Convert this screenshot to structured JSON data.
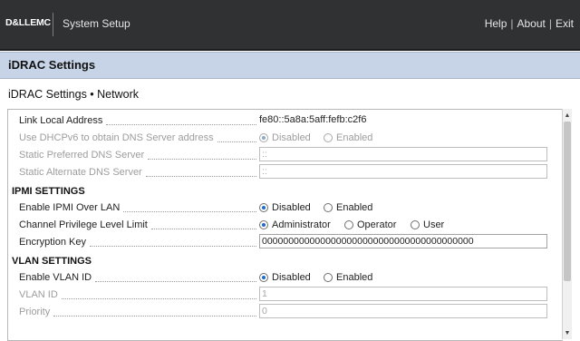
{
  "topbar": {
    "logo": "D&LLEMC",
    "app_title": "System Setup",
    "help": "Help",
    "about": "About",
    "exit": "Exit",
    "sep": "|"
  },
  "header": {
    "title": "iDRAC Settings"
  },
  "subheader": {
    "title": "iDRAC Settings • Network"
  },
  "rows": {
    "link_local": {
      "label": "Link Local Address",
      "value": "fe80::5a8a:5aff:fefb:c2f6"
    },
    "dhcpv6_dns": {
      "label": "Use DHCPv6 to obtain DNS Server address",
      "options": [
        "Disabled",
        "Enabled"
      ],
      "selected": "Disabled"
    },
    "static_pref_dns": {
      "label": "Static Preferred DNS Server",
      "value": "::"
    },
    "static_alt_dns": {
      "label": "Static Alternate DNS Server",
      "value": "::"
    }
  },
  "ipmi": {
    "section_title": "IPMI SETTINGS",
    "enable_ipmi": {
      "label": "Enable IPMI Over LAN",
      "options": [
        "Disabled",
        "Enabled"
      ],
      "selected": "Disabled"
    },
    "channel_priv": {
      "label": "Channel Privilege Level Limit",
      "options": [
        "Administrator",
        "Operator",
        "User"
      ],
      "selected": "Administrator"
    },
    "encryption_key": {
      "label": "Encryption Key",
      "value": "0000000000000000000000000000000000000000"
    }
  },
  "vlan": {
    "section_title": "VLAN SETTINGS",
    "enable_vlan": {
      "label": "Enable VLAN ID",
      "options": [
        "Disabled",
        "Enabled"
      ],
      "selected": "Disabled"
    },
    "vlan_id": {
      "label": "VLAN ID",
      "value": "1"
    },
    "priority": {
      "label": "Priority",
      "value": "0"
    }
  },
  "colors": {
    "topbar_bg": "#2f3133",
    "header_bg": "#c7d3e6",
    "radio_selected": "#1e6bd0"
  }
}
